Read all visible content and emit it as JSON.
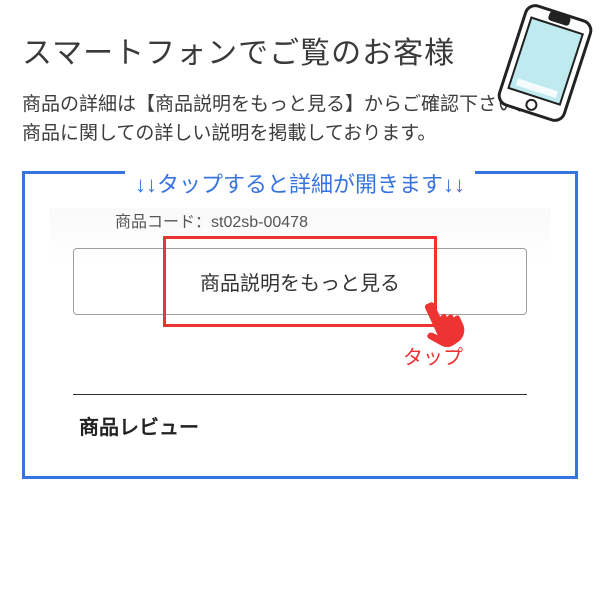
{
  "title": "スマートフォンでご覧のお客様",
  "description_line1": "商品の詳細は【商品説明をもっと見る】からご確認下さい。",
  "description_line2": "商品に関しての詳しい説明を掲載しております。",
  "panel_header": "↓↓タップすると詳細が開きます↓↓",
  "product_code_label": "商品コード：",
  "product_code_value": "st02sb-00478",
  "expand_button_label": "商品説明をもっと見る",
  "tap_label": "タップ",
  "review_heading": "商品レビュー"
}
